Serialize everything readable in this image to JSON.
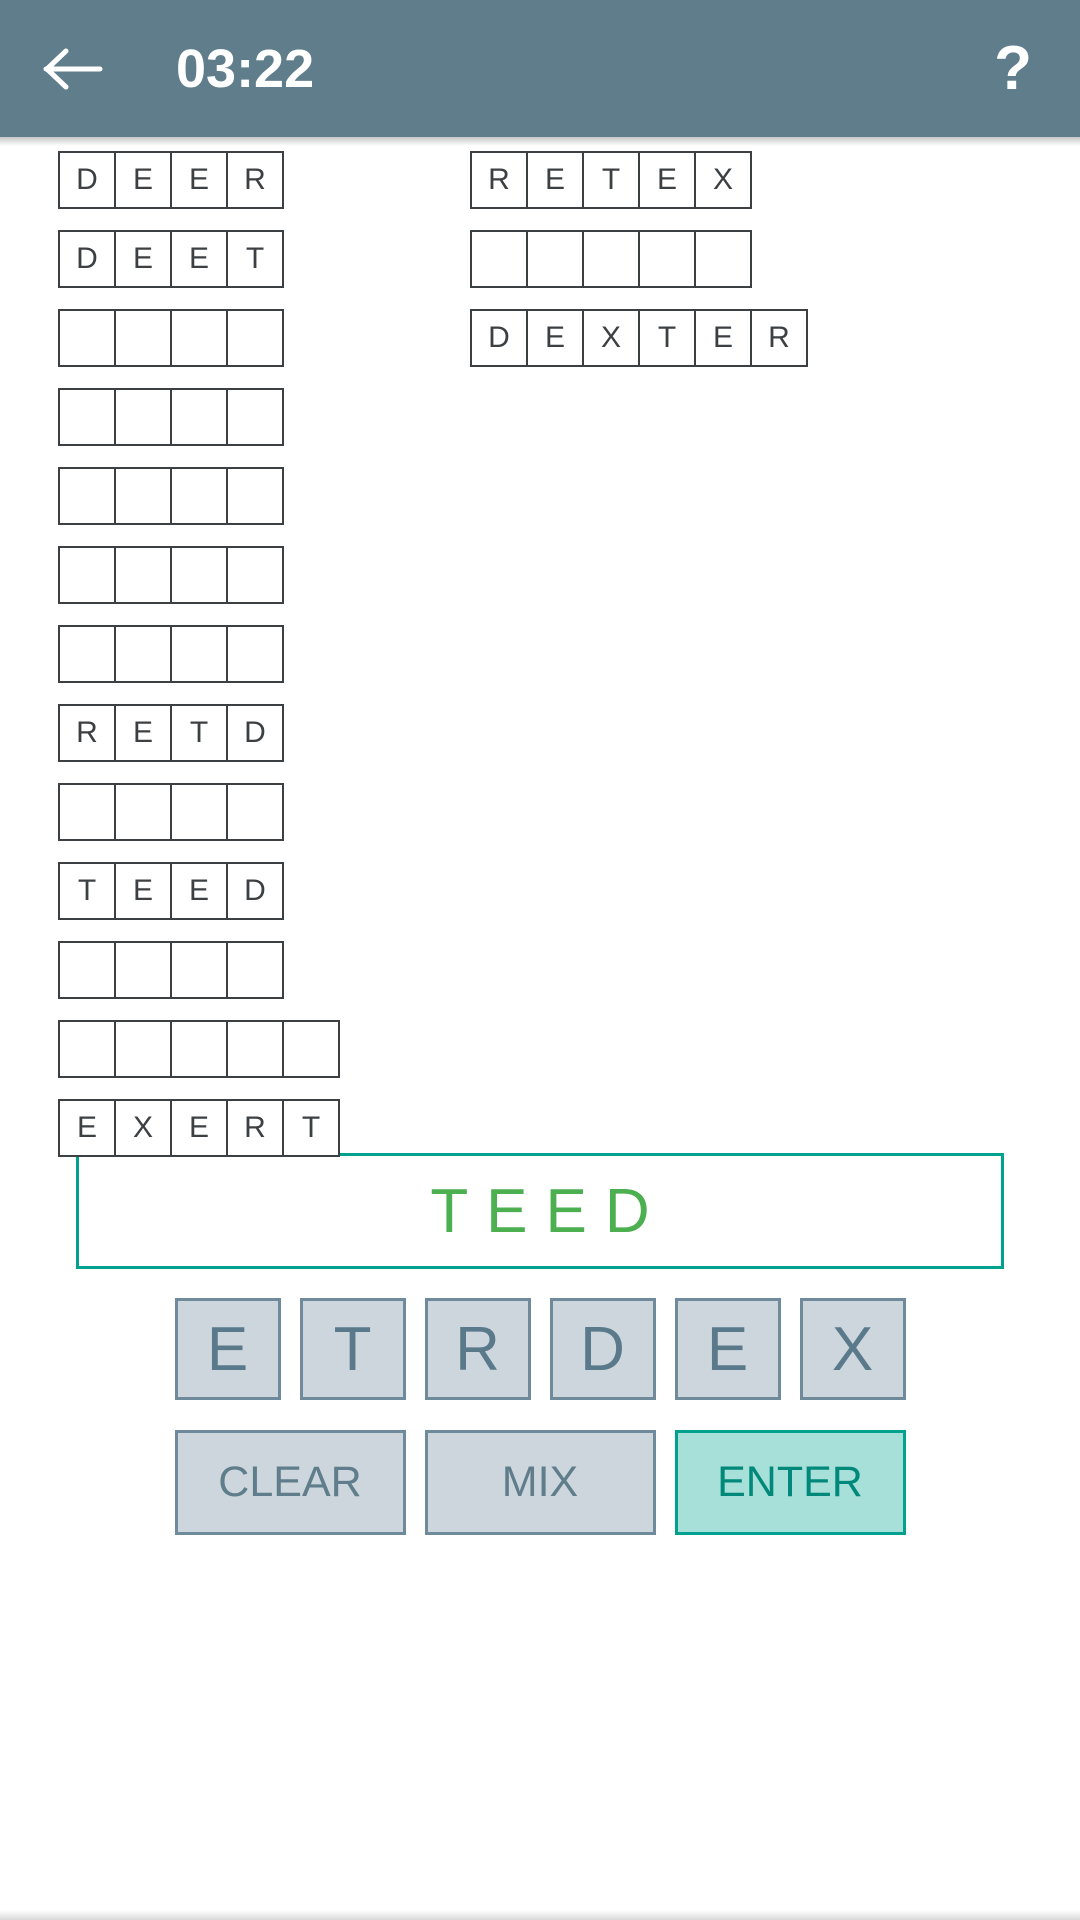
{
  "appbar": {
    "back_icon": "arrow-left-icon",
    "timer": "03:22",
    "help_label": "?",
    "background_color": "#607d8b",
    "text_color": "#ffffff"
  },
  "board": {
    "left_column": [
      {
        "letters": [
          "D",
          "E",
          "E",
          "R"
        ],
        "length": 4,
        "solved": true
      },
      {
        "letters": [
          "D",
          "E",
          "E",
          "T"
        ],
        "length": 4,
        "solved": true
      },
      {
        "letters": [
          "",
          "",
          "",
          ""
        ],
        "length": 4,
        "solved": false
      },
      {
        "letters": [
          "",
          "",
          "",
          ""
        ],
        "length": 4,
        "solved": false
      },
      {
        "letters": [
          "",
          "",
          "",
          ""
        ],
        "length": 4,
        "solved": false
      },
      {
        "letters": [
          "",
          "",
          "",
          ""
        ],
        "length": 4,
        "solved": false
      },
      {
        "letters": [
          "",
          "",
          "",
          ""
        ],
        "length": 4,
        "solved": false
      },
      {
        "letters": [
          "R",
          "E",
          "T",
          "D"
        ],
        "length": 4,
        "solved": true
      },
      {
        "letters": [
          "",
          "",
          "",
          ""
        ],
        "length": 4,
        "solved": false
      },
      {
        "letters": [
          "T",
          "E",
          "E",
          "D"
        ],
        "length": 4,
        "solved": true
      },
      {
        "letters": [
          "",
          "",
          "",
          ""
        ],
        "length": 4,
        "solved": false
      },
      {
        "letters": [
          "",
          "",
          "",
          "",
          ""
        ],
        "length": 5,
        "solved": false
      },
      {
        "letters": [
          "E",
          "X",
          "E",
          "R",
          "T"
        ],
        "length": 5,
        "solved": true
      }
    ],
    "right_column": [
      {
        "letters": [
          "R",
          "E",
          "T",
          "E",
          "X"
        ],
        "length": 5,
        "solved": true
      },
      {
        "letters": [
          "",
          "",
          "",
          "",
          ""
        ],
        "length": 5,
        "solved": false
      },
      {
        "letters": [
          "D",
          "E",
          "X",
          "T",
          "E",
          "R"
        ],
        "length": 6,
        "solved": true
      }
    ],
    "cell_border_color": "#3c4043",
    "cell_text_color": "#3c4043"
  },
  "current_word": {
    "text": "TEED",
    "text_color": "#4caf50",
    "border_color": "#00a28f"
  },
  "keyboard": {
    "letters": [
      "E",
      "T",
      "R",
      "D",
      "E",
      "X"
    ],
    "key_fill": "#ccd6dc",
    "key_border": "#6e8a9b",
    "key_text_color": "#5a7a8c"
  },
  "actions": {
    "clear_label": "CLEAR",
    "mix_label": "MIX",
    "enter_label": "ENTER",
    "enter_fill": "#a7e0d8",
    "enter_border": "#00a28f",
    "enter_text_color": "#00897b"
  }
}
